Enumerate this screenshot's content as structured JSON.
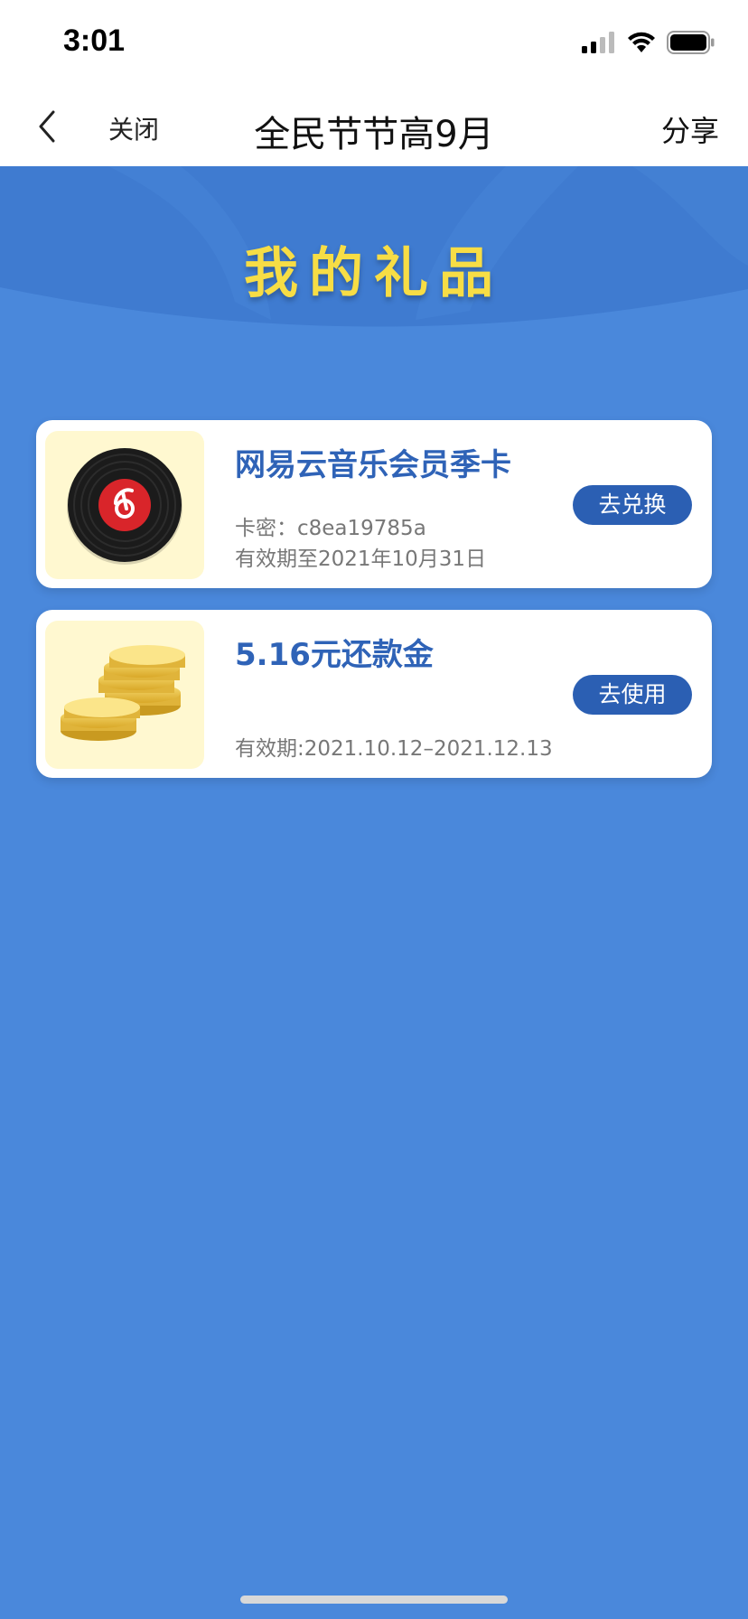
{
  "status_bar": {
    "time": "3:01"
  },
  "nav": {
    "back_icon": "chevron-left-icon",
    "close_label": "关闭",
    "title": "全民节节高9月",
    "share_label": "分享"
  },
  "banner": {
    "title": "我的礼品"
  },
  "gifts": [
    {
      "title": "网易云音乐会员季卡",
      "line1": "卡密：c8ea19785a",
      "line2": "有效期至2021年10月31日",
      "button": "去兑换",
      "icon": "vinyl-record-icon"
    },
    {
      "title": "5.16元还款金",
      "line1": "",
      "line2": "有效期:2021.10.12–2021.12.13",
      "button": "去使用",
      "icon": "gold-coins-icon"
    }
  ],
  "colors": {
    "background": "#4a88db",
    "banner_title": "#f7dd45",
    "card_title": "#2f63b7",
    "button": "#2b5fb3"
  }
}
